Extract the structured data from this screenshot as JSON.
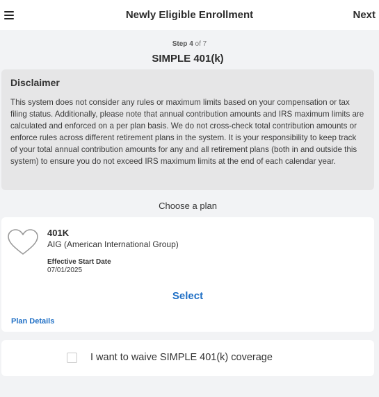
{
  "header": {
    "menu_icon": "hamburger-menu-icon",
    "title": "Newly Eligible Enrollment",
    "next_label": "Next"
  },
  "step": {
    "label": "Step",
    "current": "4",
    "separator": "of",
    "total": "7"
  },
  "plan_type_title": "SIMPLE 401(k)",
  "disclaimer": {
    "title": "Disclaimer",
    "text": "This system does not consider any rules or maximum limits based on your compensation or tax filing status. Additionally, please note that annual contribution amounts and IRS maximum limits are calculated and enforced on a per plan basis. We do not cross-check total contribution amounts or enforce rules across different retirement plans in the system. It is your responsibility to keep track of your total annual contribution amounts for any and all retirement plans (both in and outside this system) to ensure you do not exceed IRS maximum limits at the end of each calendar year."
  },
  "choose_label": "Choose a plan",
  "plan": {
    "icon": "heart-icon",
    "name": "401K",
    "provider": "AIG (American International Group)",
    "effective_label": "Effective Start Date",
    "effective_date": "07/01/2025",
    "select_label": "Select",
    "details_label": "Plan Details"
  },
  "waive": {
    "checked": false,
    "label": "I want to waive SIMPLE 401(k) coverage"
  }
}
